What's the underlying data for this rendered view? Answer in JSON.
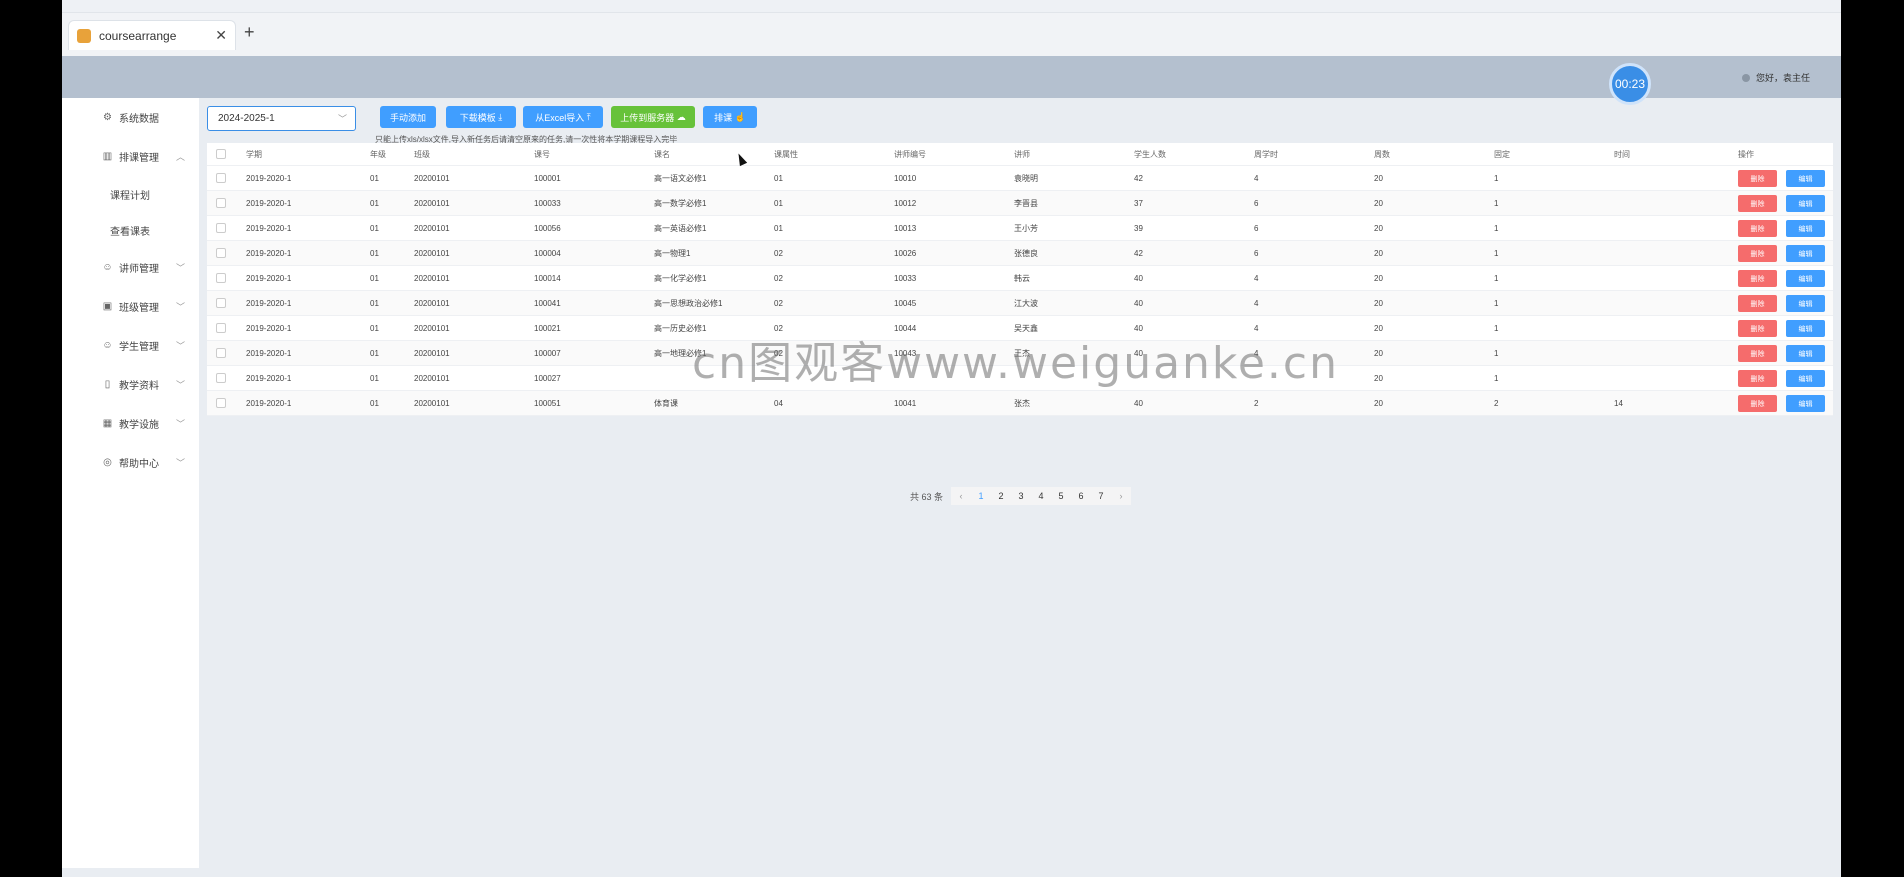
{
  "browser": {
    "tab_title": "coursearrange",
    "new_tab": "+",
    "close": "✕"
  },
  "header": {
    "timer": "00:23",
    "user_greeting": "您好，袁主任"
  },
  "sidebar": {
    "items": [
      {
        "label": "系统数据",
        "icon": "gear-icon"
      },
      {
        "label": "排课管理",
        "icon": "chart-icon",
        "expanded": true
      },
      {
        "label": "课程计划",
        "sub": true
      },
      {
        "label": "查看课表",
        "sub": true
      },
      {
        "label": "讲师管理",
        "icon": "user-icon"
      },
      {
        "label": "班级管理",
        "icon": "box-icon"
      },
      {
        "label": "学生管理",
        "icon": "user-icon"
      },
      {
        "label": "教学资料",
        "icon": "book-icon"
      },
      {
        "label": "教学设施",
        "icon": "building-icon"
      },
      {
        "label": "帮助中心",
        "icon": "help-icon"
      }
    ]
  },
  "toolbar": {
    "semester": "2024-2025-1",
    "add": "手动添加",
    "download": "下载模板",
    "import": "从Excel导入",
    "upload": "上传到服务器",
    "arrange": "排课",
    "hint": "只能上传xls/xlsx文件,导入新任务后请清空原来的任务,请一次性将本学期课程导入完毕"
  },
  "table": {
    "headers": [
      "学期",
      "年级",
      "班级",
      "课号",
      "课名",
      "课属性",
      "讲师编号",
      "讲师",
      "学生人数",
      "周学时",
      "周数",
      "固定",
      "时间",
      "操作"
    ],
    "delete_label": "删除",
    "edit_label": "编辑",
    "rows": [
      [
        "2019-2020-1",
        "01",
        "20200101",
        "100001",
        "高一语文必修1",
        "01",
        "10010",
        "袁晓明",
        "42",
        "4",
        "20",
        "1",
        ""
      ],
      [
        "2019-2020-1",
        "01",
        "20200101",
        "100033",
        "高一数学必修1",
        "01",
        "10012",
        "李晋县",
        "37",
        "6",
        "20",
        "1",
        ""
      ],
      [
        "2019-2020-1",
        "01",
        "20200101",
        "100056",
        "高一英语必修1",
        "01",
        "10013",
        "王小芳",
        "39",
        "6",
        "20",
        "1",
        ""
      ],
      [
        "2019-2020-1",
        "01",
        "20200101",
        "100004",
        "高一物理1",
        "02",
        "10026",
        "张德良",
        "42",
        "6",
        "20",
        "1",
        ""
      ],
      [
        "2019-2020-1",
        "01",
        "20200101",
        "100014",
        "高一化学必修1",
        "02",
        "10033",
        "韩云",
        "40",
        "4",
        "20",
        "1",
        ""
      ],
      [
        "2019-2020-1",
        "01",
        "20200101",
        "100041",
        "高一思想政治必修1",
        "02",
        "10045",
        "江大波",
        "40",
        "4",
        "20",
        "1",
        ""
      ],
      [
        "2019-2020-1",
        "01",
        "20200101",
        "100021",
        "高一历史必修1",
        "02",
        "10044",
        "吴天鑫",
        "40",
        "4",
        "20",
        "1",
        ""
      ],
      [
        "2019-2020-1",
        "01",
        "20200101",
        "100007",
        "高一地理必修1",
        "02",
        "10043",
        "王杰",
        "40",
        "4",
        "20",
        "1",
        ""
      ],
      [
        "2019-2020-1",
        "01",
        "20200101",
        "100027",
        "",
        "",
        "",
        "",
        "",
        "",
        "20",
        "1",
        ""
      ],
      [
        "2019-2020-1",
        "01",
        "20200101",
        "100051",
        "体育课",
        "04",
        "10041",
        "张杰",
        "40",
        "2",
        "20",
        "2",
        "14"
      ]
    ]
  },
  "pagination": {
    "total": "共 63 条",
    "prev": "‹",
    "next": "›",
    "pages": [
      "1",
      "2",
      "3",
      "4",
      "5",
      "6",
      "7"
    ],
    "current": "1"
  },
  "watermark": "cn图观客www.weiguanke.cn"
}
